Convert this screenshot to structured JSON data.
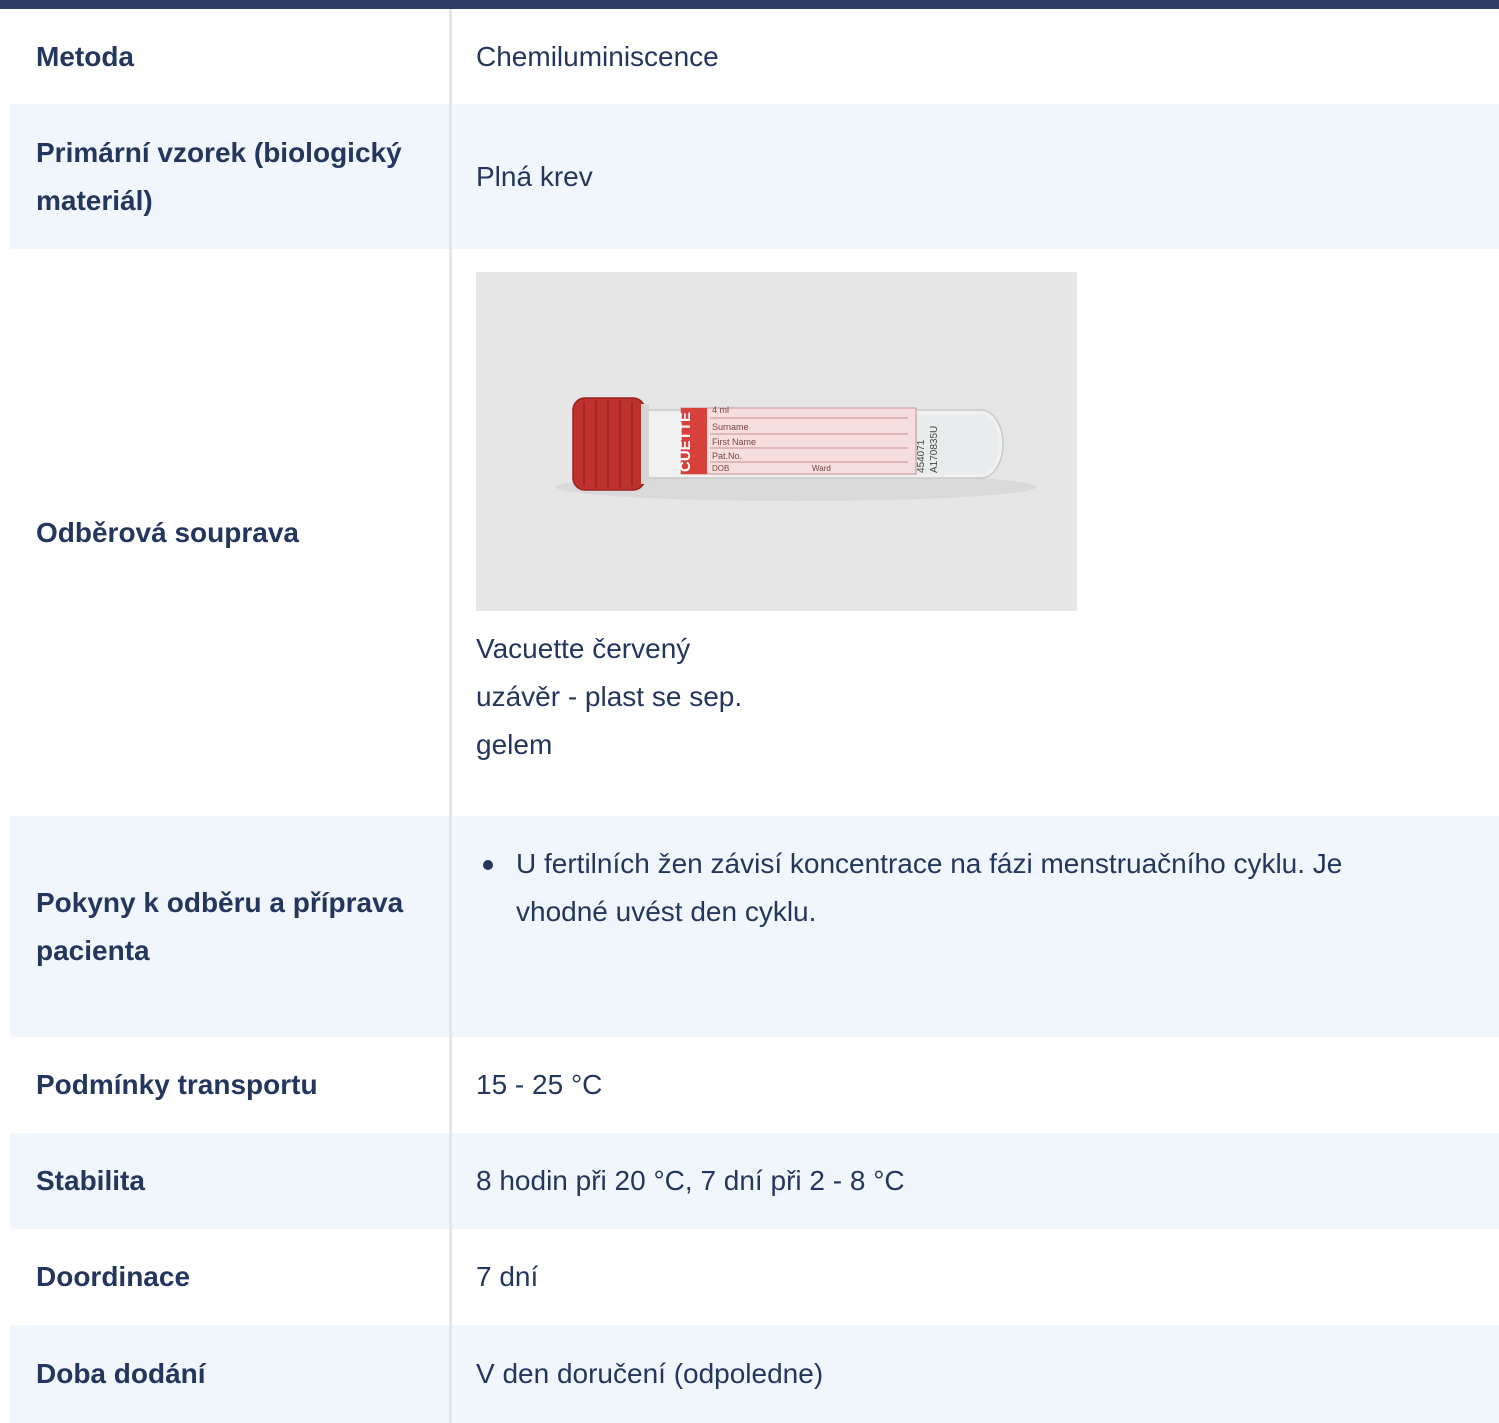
{
  "rows": [
    {
      "label": "Metoda",
      "value": "Chemiluminiscence"
    },
    {
      "label": "Primární vzorek (biologický materiál)",
      "value": "Plná krev"
    },
    {
      "label": "Odběrová souprava",
      "image": {
        "tube_band_text": "CUETTE",
        "volume_text": "4 ml",
        "fields": [
          "Surname",
          "First Name",
          "Pat.No.",
          "DOB",
          "Ward"
        ],
        "codes": [
          "454071",
          "A170835U"
        ],
        "colors": {
          "cap": "#c0322e",
          "label_band": "#d8413b",
          "background": "#e6e6e6"
        }
      },
      "caption": "Vacuette červený uzávěr - plast se sep. gelem"
    },
    {
      "label": "Pokyny k odběru a příprava pacienta",
      "notes": [
        "U fertilních žen závisí koncentrace na fázi menstruačního cyklu. Je vhodné uvést den cyklu."
      ]
    },
    {
      "label": "Podmínky transportu",
      "value": "15 - 25 °C"
    },
    {
      "label": "Stabilita",
      "value": "8 hodin při 20 °C, 7 dní při 2 - 8 °C"
    },
    {
      "label": "Doordinace",
      "value": "7 dní"
    },
    {
      "label": "Doba dodání",
      "value": "V den doručení (odpoledne)"
    }
  ],
  "colors": {
    "accent": "#2c3e66",
    "text": "#25365e",
    "alt_row": "#f1f6fc"
  }
}
